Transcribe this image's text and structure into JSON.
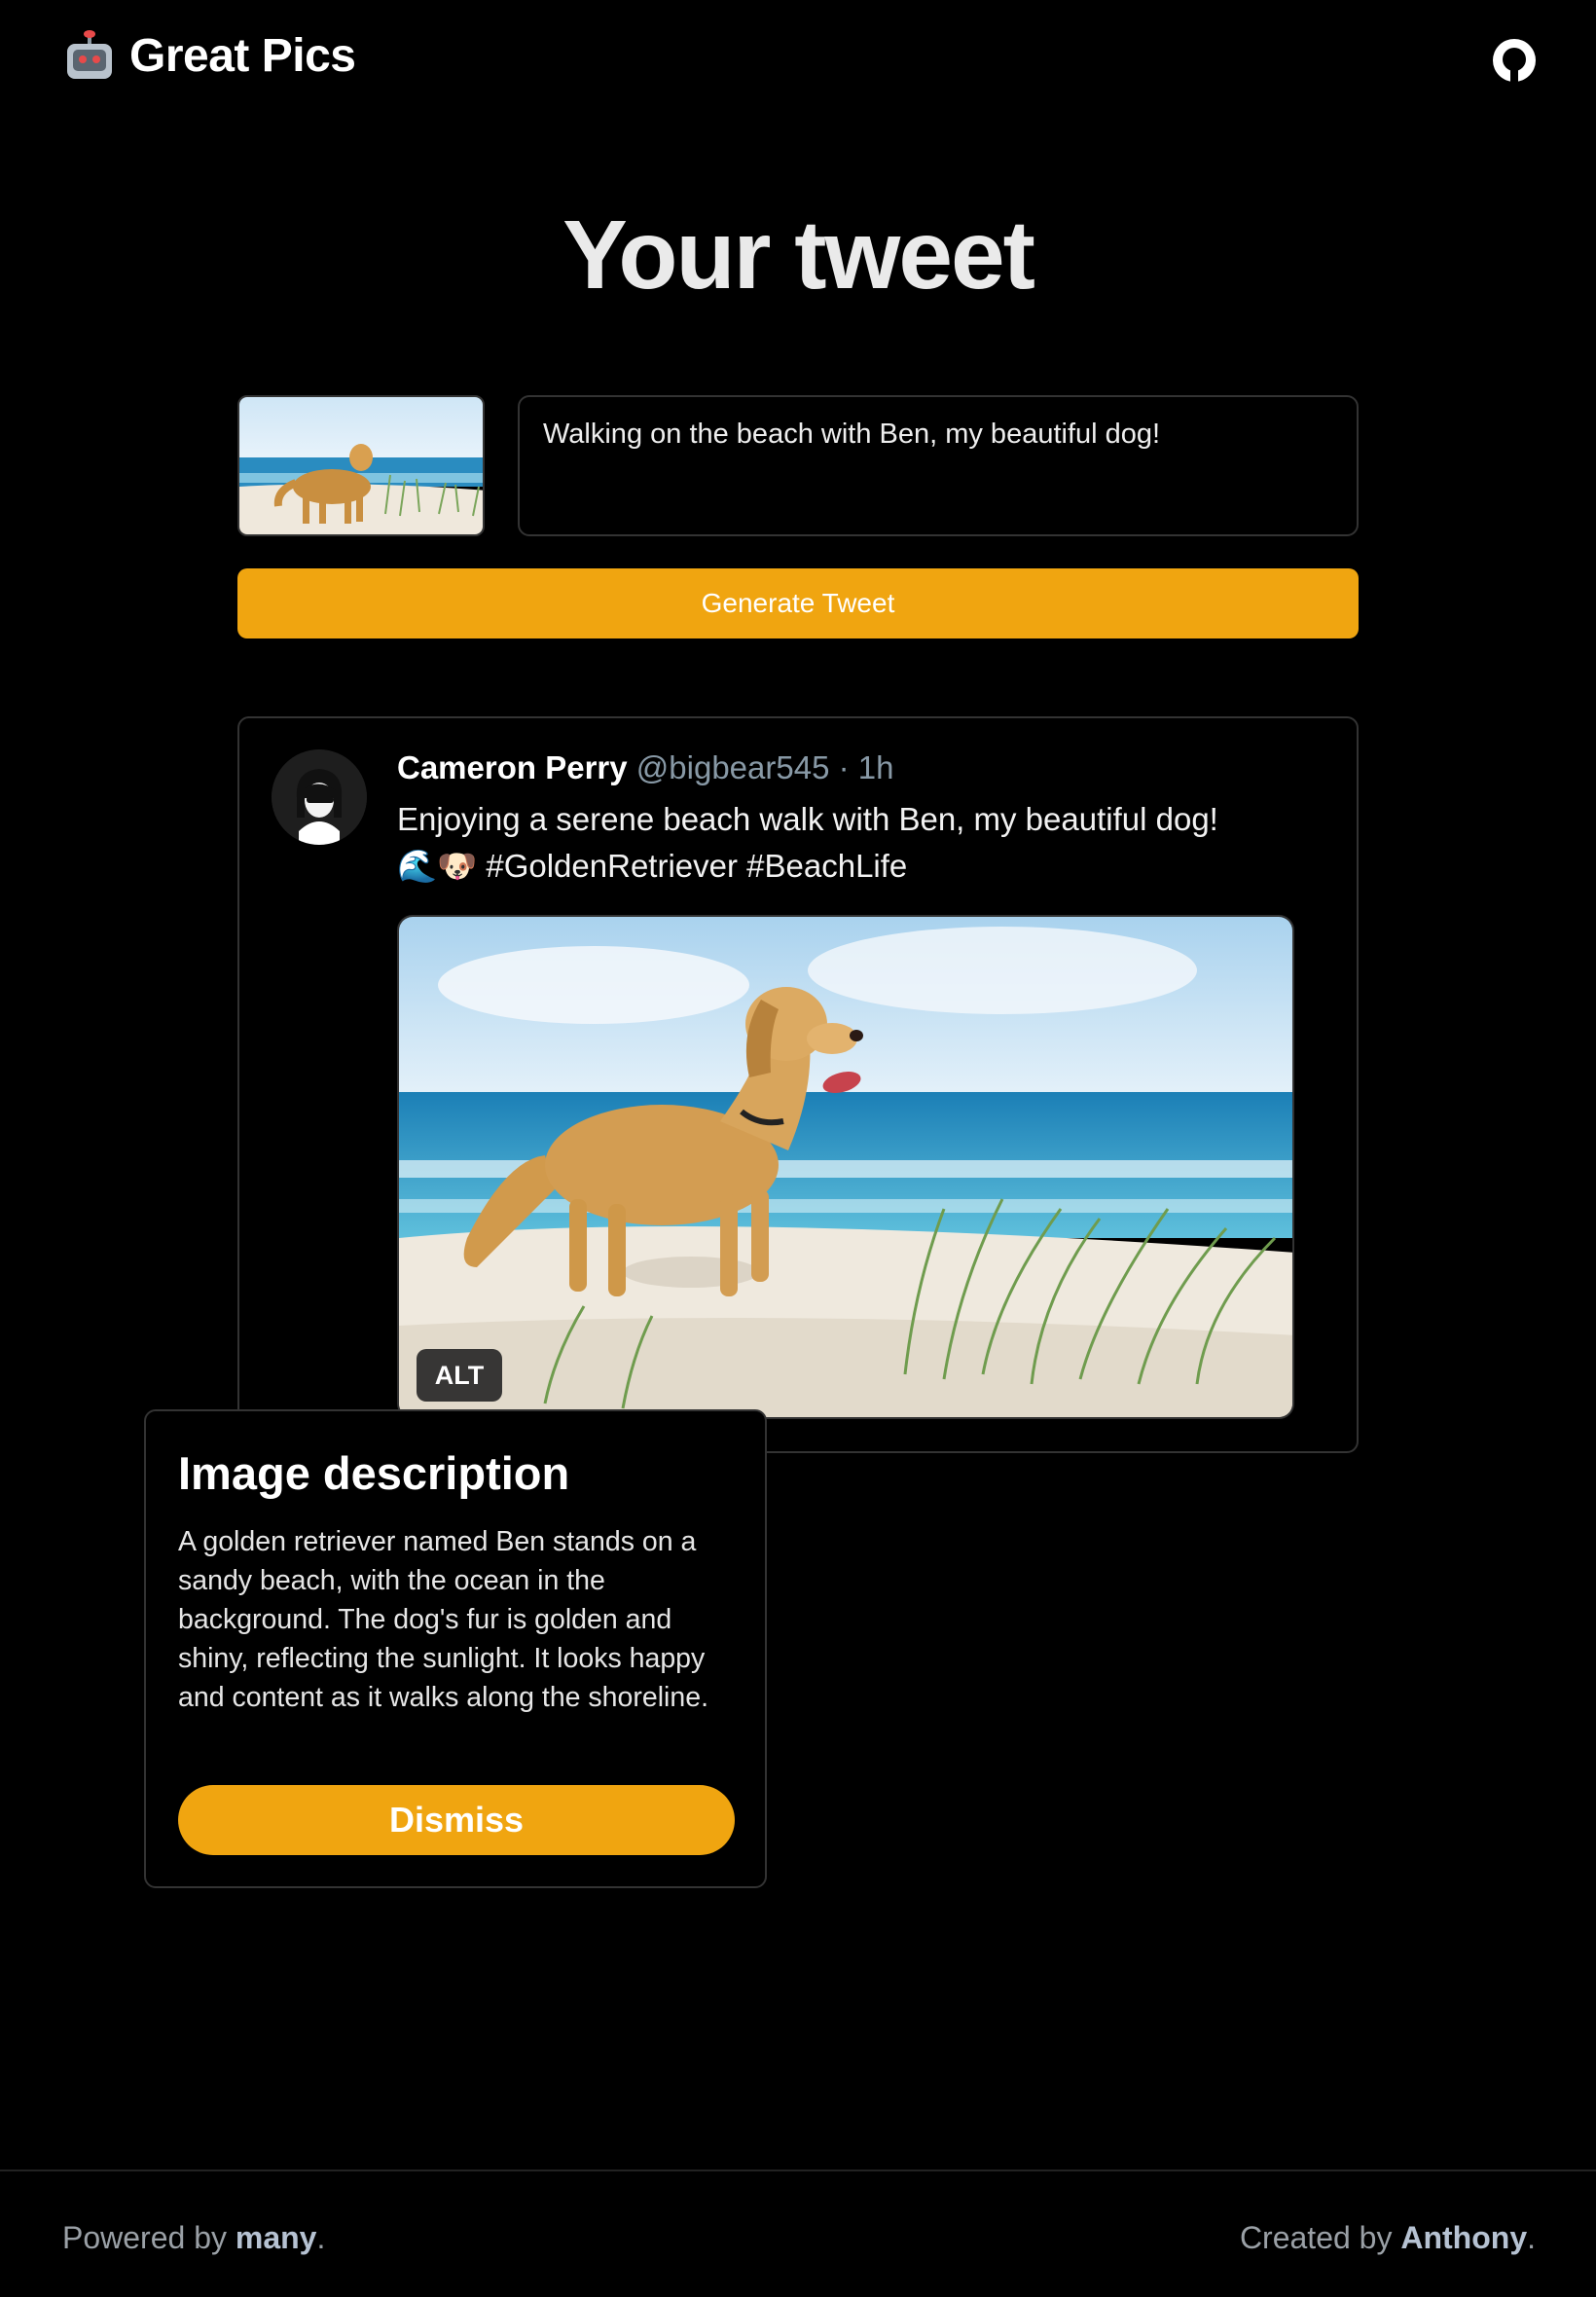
{
  "header": {
    "brand_title": "Great Pics",
    "brand_icon": "robot-icon",
    "github_icon": "github-icon"
  },
  "page": {
    "title": "Your tweet"
  },
  "composer": {
    "text_value": "Walking on the beach with Ben, my beautiful dog!",
    "generate_label": "Generate Tweet",
    "accent_color": "#f0a510"
  },
  "tweet": {
    "name": "Cameron Perry",
    "handle": "@bigbear545",
    "separator": "·",
    "time": "1h",
    "text": "Enjoying a serene beach walk with Ben, my beautiful dog! 🌊🐶 #GoldenRetriever #BeachLife",
    "alt_label": "ALT"
  },
  "alt_popover": {
    "title": "Image description",
    "text": "A golden retriever named Ben stands on a sandy beach, with the ocean in the background. The dog's fur is golden and shiny, reflecting the sunlight. It looks happy and content as it walks along the shoreline.",
    "dismiss_label": "Dismiss"
  },
  "footer": {
    "left_prefix": "Powered by ",
    "left_link": "many",
    "left_suffix": ".",
    "right_prefix": "Created by ",
    "right_link": "Anthony",
    "right_suffix": "."
  }
}
